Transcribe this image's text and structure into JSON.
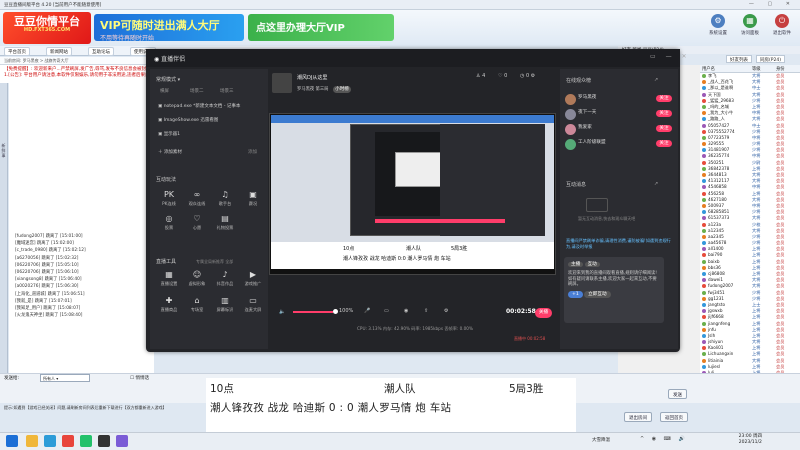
{
  "bg": {
    "title": "豆豆直播间版平台 4.20 [当前用户不能随意使用]",
    "logo_text": "豆豆你情平台",
    "logo_url": "HD.FXT365.COM",
    "ad1_big": "VIP可随时进出满人大厅",
    "ad1_small": "不用等待再随时开始",
    "ad2": "点这里办理大厅VIP",
    "top_icons": [
      "系统设置",
      "访问面板",
      "退出软件"
    ],
    "tabs": [
      "平台首页",
      "新闻网站",
      "互助论坛",
      "使用说明"
    ],
    "addr": "当前房间: 罗马黑夜 > 战旗传奇大厅",
    "notice": "【免费提醒】: 欢迎新来户...严禁刷屏,发广告,辱骂,发布不良信息会被封号",
    "notice2": "1.[公告]: 平台用户请注意,本软件仅限娱乐,请勿用于非法用途,违者后果自负!",
    "side_label": "新鲜事",
    "chatlog": [
      "[fudong2007] 跳离了 [15:01:00]",
      "[魔域迷宫] 跳离了 [15:02:00]",
      "[c_trade_0980] 跳离了 [15:02:12]",
      "[a6270056] 跳离了 [15:02:32]",
      "[06220706] 跳离了 [15:05:10]",
      "[06220706] 跳离了 [15:06:10]",
      "[xiangsong8] 跳离了 [15:06:40]",
      "[a0020276] 跳离了 [15:06:30]",
      "[上海化_道道城] 跳离了 [15:06:51]",
      "[我就_是] 跳离了 [15:07:01]",
      "[我知足_用户] 跳离了 [15:08:07]",
      "[火龙鬼天神坐] 跳离了 [15:08:40]"
    ],
    "input_label": "发送给:",
    "input_value": "所有人",
    "check_label": "悄悄话",
    "send_label": "发送",
    "tip": "提示:如遇到【游戏已经关闭】问题,请刷新房间列表后重新下载进行【双方都重新进入游戏】",
    "bottom_btns": [
      "退出房间",
      "返回首页"
    ],
    "rp_title": "好友 新闻 豆豆(P24)",
    "rp_tabs": [
      "好友列表",
      "同房(P24)"
    ],
    "rp_head": [
      "用户名",
      "等级",
      "身份"
    ],
    "members": [
      [
        "李飞",
        "大将",
        "会员"
      ],
      [
        "_战人_百花飞",
        "大将",
        "会员"
      ],
      [
        "_那以_是谁啊",
        "中士",
        "会员"
      ],
      [
        "天下国",
        "大将",
        "会员"
      ],
      [
        "_猛猛_29683",
        "少将",
        "会员"
      ],
      [
        "_吗的_名城",
        "上将",
        "会员"
      ],
      [
        "_我为_大小牛",
        "中将",
        "会员"
      ],
      [
        "_路路_人",
        "大将",
        "会员"
      ],
      [
        "05057427",
        "中士",
        "会员"
      ],
      [
        "0375552774",
        "少将",
        "会员"
      ],
      [
        "07723579",
        "中将",
        "会员"
      ],
      [
        "329555",
        "少将",
        "会员"
      ],
      [
        "31481907",
        "少将",
        "会员"
      ],
      [
        "36235774",
        "中将",
        "会员"
      ],
      [
        "350251",
        "少尉",
        "会员"
      ],
      [
        "36842378",
        "上将",
        "会员"
      ],
      [
        "3644813",
        "大将",
        "会员"
      ],
      [
        "41312117",
        "大将",
        "会员"
      ],
      [
        "4546858",
        "中将",
        "会员"
      ],
      [
        "456258",
        "上将",
        "会员"
      ],
      [
        "4627180",
        "大将",
        "会员"
      ],
      [
        "500937",
        "中将",
        "会员"
      ],
      [
        "68285851",
        "少将",
        "会员"
      ],
      [
        "61537373",
        "大将",
        "会员"
      ],
      [
        "a123a",
        "少校",
        "会员"
      ],
      [
        "a12345",
        "大将",
        "会员"
      ],
      [
        "aa2345",
        "少将",
        "会员"
      ],
      [
        "aa45678",
        "少将",
        "会员"
      ],
      [
        "all1400",
        "上将",
        "会员"
      ],
      [
        "bai790",
        "上将",
        "会员"
      ],
      [
        "baixb",
        "上将",
        "会员"
      ],
      [
        "bbs36",
        "上将",
        "会员"
      ],
      [
        "cj86808",
        "上将",
        "会员"
      ],
      [
        "dawei1",
        "大将",
        "会员"
      ],
      [
        "fudong2007",
        "大将",
        "会员"
      ],
      [
        "fwj3451",
        "少将",
        "会员"
      ],
      [
        "gg1231",
        "少将",
        "会员"
      ],
      [
        "jangtsto",
        "上士",
        "会员"
      ],
      [
        "jgswxb",
        "上将",
        "会员"
      ],
      [
        "jijf6668",
        "上将",
        "会员"
      ],
      [
        "jiangnfeng",
        "上将",
        "会员"
      ],
      [
        "jnfu",
        "上将",
        "会员"
      ],
      [
        "Jslh",
        "上将",
        "会员"
      ],
      [
        "jshiyun",
        "大将",
        "会员"
      ],
      [
        "Kaoli01",
        "上将",
        "会员"
      ],
      [
        "Lichuangxin",
        "上将",
        "会员"
      ],
      [
        "litiainia",
        "大将",
        "会员"
      ],
      [
        "lujiesl",
        "上将",
        "会员"
      ],
      [
        "luli",
        "上将",
        "会员"
      ],
      [
        "nshaw",
        "大将",
        "会员"
      ],
      [
        "qianping",
        "少将",
        "会员"
      ],
      [
        "qiuqiu001",
        "大将",
        "会员"
      ],
      [
        "rigzhuxia",
        "上将",
        "会员"
      ]
    ]
  },
  "stream": {
    "app_title": "直播伴侣",
    "source_header": "常规模式",
    "scene_tabs": [
      "横屏",
      "场景二",
      "场景三"
    ],
    "sources": [
      "notepad.exe *新建文本文档 - 记事本",
      "ImageShow.exe 迅雷看图",
      "显示器1"
    ],
    "add_source": "添加素材",
    "add_source_right": "添加",
    "interact_header": "互动玩法",
    "interact_buttons": [
      "PK连线",
      "观众连线",
      "歌手台",
      "赛况",
      "投票",
      "心愿",
      "礼物投票"
    ],
    "tools_header": "直播工具",
    "tools_note": "专属全局新推荐 全部",
    "tool_buttons": [
      "直播设置",
      "虚拟形象",
      "抖音作品",
      "游戏推广",
      "直播商品",
      "专场室",
      "屏幕标识",
      "连麦大屏"
    ],
    "host_name": "潮风DJ从这里",
    "host_tag": "小时榜",
    "room_info": "罗马黑夜 第三局",
    "viewers": "4",
    "likes": "0",
    "audience_header": "在线观众榜",
    "audience_list": [
      "罗马黑夜",
      "夜下一天",
      "我爱家",
      "工人阶级联盟"
    ],
    "audience_btn": "关注",
    "interact_msg_header": "互动消息",
    "interact_empty": "暂无互动消息,快去和观众聊天吧",
    "notice_text": "直播间严禁刷单诈骗,请理性消费,谨防被骗!如遇到违规行为,请及时举报",
    "card_tags": [
      "主播",
      "互动"
    ],
    "card_text": "欢迎来到我的直播间观看直播,规则请仔细阅读!",
    "card_text2": "如有疑问请联系主播,欢迎大家一起来互动,不要刷屏。",
    "card_btn": "立即互动",
    "card_like": "+1",
    "preview_line1": [
      "10点",
      "潮人队",
      "5局3胜"
    ],
    "preview_line2": "潮人锋孜孜 战龙 哈迪斯 0:0 潮人罗马情 炮 车站",
    "volume_pct": "100%",
    "timer": "00:02:58",
    "stop_btn": "关播",
    "status": "CPU: 3.13%   内存: 42.90%   码率: 1985kbps   丢帧率: 0.00%",
    "status_red": "直播中 00:02:58"
  },
  "subtitle": {
    "line1_a": "10点",
    "line1_b": "潮人队",
    "line1_c": "5局3胜",
    "line2": "潮人锋孜孜  战龙  哈迪斯  0 : 0  潮人罗马情  炮  车站"
  },
  "taskbar": {
    "tray": "大雪降温",
    "time": "23:00 周四",
    "date": "2023/11/2"
  }
}
